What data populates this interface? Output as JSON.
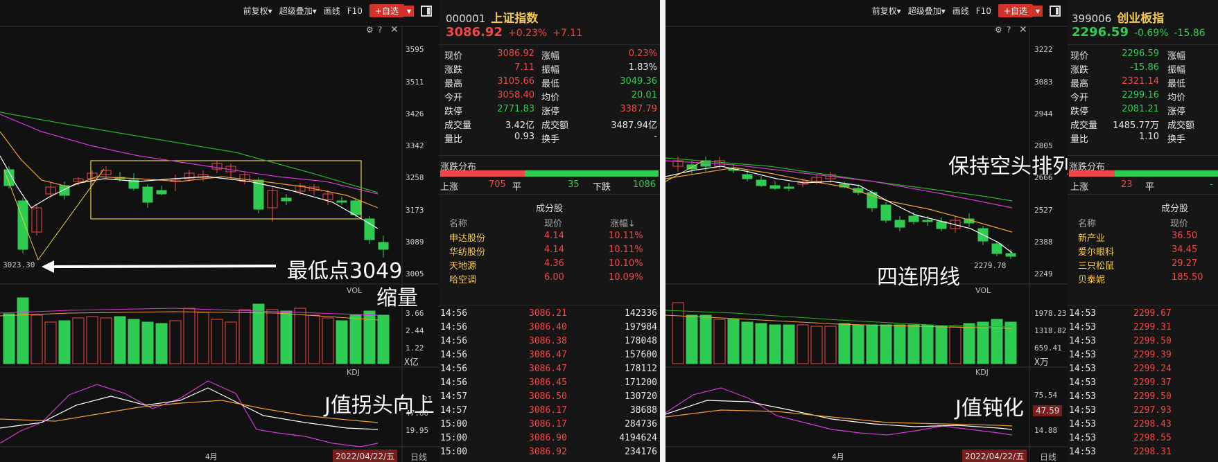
{
  "left": {
    "toolbar": {
      "adjust": "前复权▾",
      "overlay": "超级叠加▾",
      "draw": "画线",
      "f10": "F10",
      "add": "+自选",
      "add_arrow": "▾"
    },
    "price_axis": [
      "3595",
      "3511",
      "3426",
      "3342",
      "3258",
      "3173",
      "3089",
      "3005"
    ],
    "low_label": "3023.30",
    "vol_label": "VOL",
    "vol_axis": [
      "3.66",
      "2.44",
      "1.22",
      "X亿"
    ],
    "kdj_label": "KDJ",
    "kdj_axis": [
      "47.60",
      "19.95"
    ],
    "kdj_top": "21",
    "month": "4月",
    "date": "2022/04/22/五",
    "period": "日线",
    "annotations": {
      "lowest": "最低点3049",
      "shrink": "缩量",
      "j_up": "J值拐头向上"
    },
    "quote": {
      "code": "000001",
      "name": "上证指数",
      "price": "3086.92",
      "chg_pct": "+0.23%",
      "chg": "+7.11",
      "rows": [
        [
          "现价",
          "3086.92",
          "red",
          "涨幅",
          "0.23%",
          "red"
        ],
        [
          "涨跌",
          "7.11",
          "red",
          "振幅",
          "1.83%",
          "white"
        ],
        [
          "最高",
          "3105.66",
          "red",
          "最低",
          "3049.36",
          "green"
        ],
        [
          "今开",
          "3058.40",
          "red",
          "均价",
          "20.01",
          "green"
        ],
        [
          "跌停",
          "2771.83",
          "green",
          "涨停",
          "3387.79",
          "red"
        ],
        [
          "成交量",
          "3.42亿",
          "white",
          "成交额",
          "3487.94亿",
          "white"
        ],
        [
          "量比",
          "0.93",
          "white",
          "换手",
          "-",
          "white"
        ]
      ],
      "dist_title": "涨跌分布",
      "up_label": "上涨",
      "up": "705",
      "flat_label": "平",
      "flat": "35",
      "down_label": "下跌",
      "down": "1086",
      "comp_title": "成分股",
      "comp_headers": [
        "名称",
        "现价",
        "涨幅↓"
      ],
      "components": [
        [
          "申达股份",
          "4.14",
          "10.11%"
        ],
        [
          "华纺股份",
          "4.14",
          "10.11%"
        ],
        [
          "天地源",
          "4.36",
          "10.10%"
        ],
        [
          "哈空调",
          "6.00",
          "10.09%"
        ]
      ],
      "ticks": [
        [
          "14:56",
          "3086.21",
          "142336"
        ],
        [
          "14:56",
          "3086.40",
          "197984"
        ],
        [
          "14:56",
          "3086.38",
          "178048"
        ],
        [
          "14:56",
          "3086.47",
          "157600"
        ],
        [
          "14:56",
          "3086.47",
          "178112"
        ],
        [
          "14:56",
          "3086.45",
          "171200"
        ],
        [
          "14:57",
          "3086.50",
          "130720"
        ],
        [
          "14:57",
          "3086.17",
          "38688"
        ],
        [
          "15:00",
          "3086.17",
          "284736"
        ],
        [
          "15:00",
          "3086.90",
          "4194624"
        ],
        [
          "15:00",
          "3086.92",
          "234176"
        ]
      ]
    }
  },
  "right": {
    "toolbar": {
      "adjust": "前复权▾",
      "overlay": "超级叠加▾",
      "draw": "画线",
      "f10": "F10",
      "add": "+自选",
      "add_arrow": "▾"
    },
    "price_axis": [
      "3222",
      "3083",
      "2944",
      "2805",
      "2666",
      "2527",
      "2388",
      "2249"
    ],
    "low_label": "2279.78",
    "vol_label": "VOL",
    "vol_axis": [
      "1978.23",
      "1318.82",
      "659.41",
      "X万"
    ],
    "kdj_label": "KDJ",
    "kdj_axis": [
      "75.54",
      "14.88"
    ],
    "kdj_highlight": "47.59",
    "month": "4月",
    "date": "2022/04/22/五",
    "period": "日线",
    "annotations": {
      "bear": "保持空头排列",
      "four": "四连阴线",
      "j_dull": "J值钝化"
    },
    "quote": {
      "code": "399006",
      "name": "创业板指",
      "price": "2296.59",
      "chg_pct": "-0.69%",
      "chg": "-15.86",
      "rows": [
        [
          "现价",
          "2296.59",
          "green",
          "涨幅"
        ],
        [
          "涨跌",
          "-15.86",
          "green",
          "振幅"
        ],
        [
          "最高",
          "2321.14",
          "red",
          "最低"
        ],
        [
          "今开",
          "2299.16",
          "green",
          "均价"
        ],
        [
          "跌停",
          "2081.21",
          "green",
          "涨停"
        ],
        [
          "成交量",
          "1485.77万",
          "white",
          "成交额"
        ],
        [
          "量比",
          "1.10",
          "white",
          "换手"
        ]
      ],
      "dist_title": "涨跌分布",
      "up_label": "上涨",
      "up": "23",
      "flat_label": "平",
      "flat": "-",
      "comp_title": "成分股",
      "comp_headers": [
        "名称",
        "现价"
      ],
      "components": [
        [
          "新产业",
          "36.50"
        ],
        [
          "爱尔眼科",
          "34.45"
        ],
        [
          "三只松鼠",
          "29.27"
        ],
        [
          "贝泰妮",
          "185.50"
        ]
      ],
      "ticks": [
        [
          "14:53",
          "2299.67"
        ],
        [
          "14:53",
          "2299.31"
        ],
        [
          "14:53",
          "2299.50"
        ],
        [
          "14:53",
          "2299.39"
        ],
        [
          "14:53",
          "2299.24"
        ],
        [
          "14:53",
          "2299.37"
        ],
        [
          "14:53",
          "2299.50"
        ],
        [
          "14:53",
          "2297.93"
        ],
        [
          "14:53",
          "2298.43"
        ],
        [
          "14:53",
          "2298.55"
        ],
        [
          "14:53",
          "2298.31"
        ]
      ]
    }
  },
  "colors": {
    "up": "#f04848",
    "down": "#2fcc52",
    "ma_white": "#ffffff",
    "ma_orange": "#f0a030",
    "ma_magenta": "#d23ad2",
    "ma_green": "#2bb02b",
    "box": "#e8d23a"
  }
}
